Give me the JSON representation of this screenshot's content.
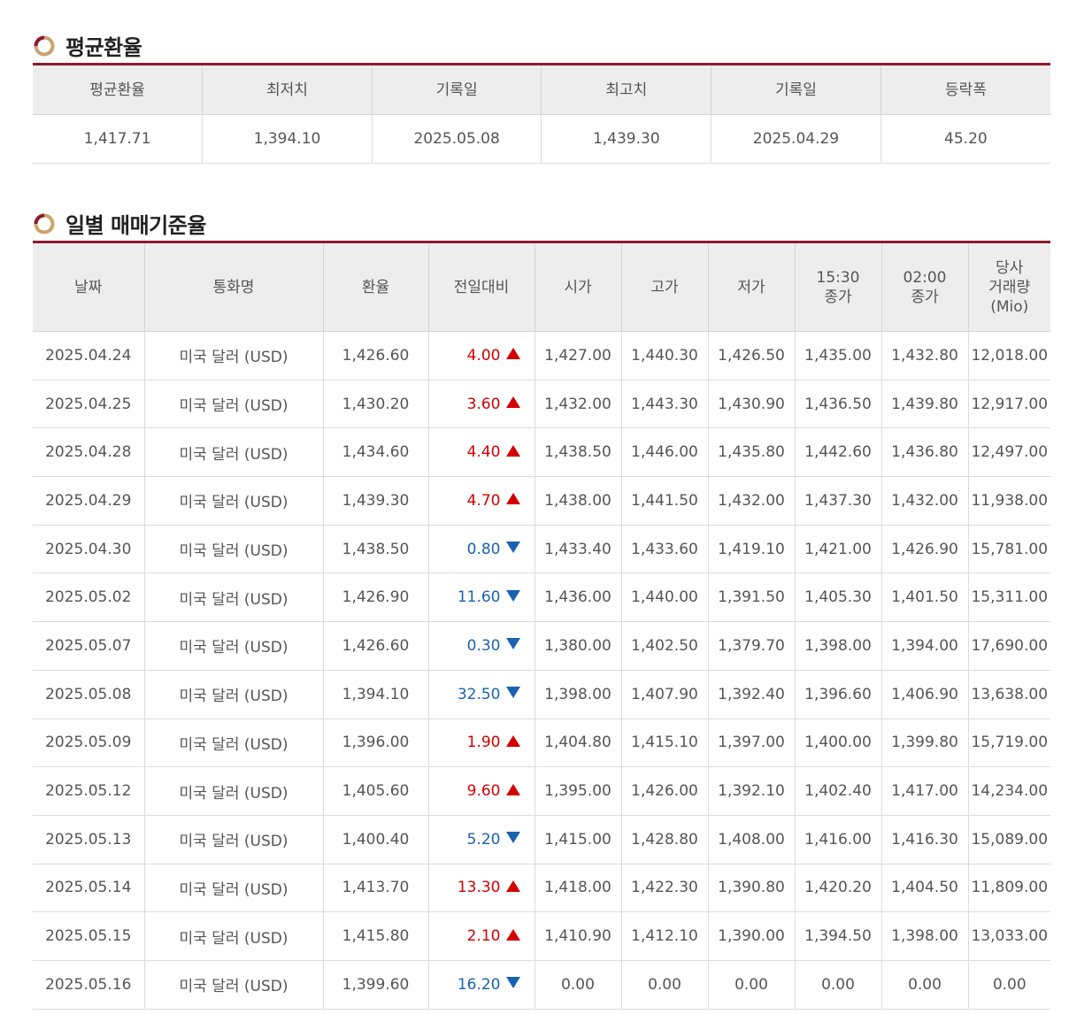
{
  "avg_section": {
    "title": "평균환율",
    "headers": [
      "평균환율",
      "최저치",
      "기록일",
      "최고치",
      "기록일",
      "등락폭"
    ],
    "values": [
      "1,417.71",
      "1,394.10",
      "2025.05.08",
      "1,439.30",
      "2025.04.29",
      "45.20"
    ]
  },
  "daily_section": {
    "title": "일별 매매기준율",
    "headers": {
      "date": "날짜",
      "currency": "통화명",
      "rate": "환율",
      "change": "전일대비",
      "open": "시가",
      "high": "고가",
      "low": "저가",
      "close1530_l1": "15:30",
      "close1530_l2": "종가",
      "close0200_l1": "02:00",
      "close0200_l2": "종가",
      "volume_l1": "당사",
      "volume_l2": "거래량",
      "volume_l3": "(Mio)"
    },
    "rows": [
      {
        "date": "2025.04.24",
        "currency": "미국 달러 (USD)",
        "rate": "1,426.60",
        "change": "4.00",
        "dir": "up",
        "open": "1,427.00",
        "high": "1,440.30",
        "low": "1,426.50",
        "c1530": "1,435.00",
        "c0200": "1,432.80",
        "volume": "12,018.00"
      },
      {
        "date": "2025.04.25",
        "currency": "미국 달러 (USD)",
        "rate": "1,430.20",
        "change": "3.60",
        "dir": "up",
        "open": "1,432.00",
        "high": "1,443.30",
        "low": "1,430.90",
        "c1530": "1,436.50",
        "c0200": "1,439.80",
        "volume": "12,917.00"
      },
      {
        "date": "2025.04.28",
        "currency": "미국 달러 (USD)",
        "rate": "1,434.60",
        "change": "4.40",
        "dir": "up",
        "open": "1,438.50",
        "high": "1,446.00",
        "low": "1,435.80",
        "c1530": "1,442.60",
        "c0200": "1,436.80",
        "volume": "12,497.00"
      },
      {
        "date": "2025.04.29",
        "currency": "미국 달러 (USD)",
        "rate": "1,439.30",
        "change": "4.70",
        "dir": "up",
        "open": "1,438.00",
        "high": "1,441.50",
        "low": "1,432.00",
        "c1530": "1,437.30",
        "c0200": "1,432.00",
        "volume": "11,938.00"
      },
      {
        "date": "2025.04.30",
        "currency": "미국 달러 (USD)",
        "rate": "1,438.50",
        "change": "0.80",
        "dir": "down",
        "open": "1,433.40",
        "high": "1,433.60",
        "low": "1,419.10",
        "c1530": "1,421.00",
        "c0200": "1,426.90",
        "volume": "15,781.00"
      },
      {
        "date": "2025.05.02",
        "currency": "미국 달러 (USD)",
        "rate": "1,426.90",
        "change": "11.60",
        "dir": "down",
        "open": "1,436.00",
        "high": "1,440.00",
        "low": "1,391.50",
        "c1530": "1,405.30",
        "c0200": "1,401.50",
        "volume": "15,311.00"
      },
      {
        "date": "2025.05.07",
        "currency": "미국 달러 (USD)",
        "rate": "1,426.60",
        "change": "0.30",
        "dir": "down",
        "open": "1,380.00",
        "high": "1,402.50",
        "low": "1,379.70",
        "c1530": "1,398.00",
        "c0200": "1,394.00",
        "volume": "17,690.00"
      },
      {
        "date": "2025.05.08",
        "currency": "미국 달러 (USD)",
        "rate": "1,394.10",
        "change": "32.50",
        "dir": "down",
        "open": "1,398.00",
        "high": "1,407.90",
        "low": "1,392.40",
        "c1530": "1,396.60",
        "c0200": "1,406.90",
        "volume": "13,638.00"
      },
      {
        "date": "2025.05.09",
        "currency": "미국 달러 (USD)",
        "rate": "1,396.00",
        "change": "1.90",
        "dir": "up",
        "open": "1,404.80",
        "high": "1,415.10",
        "low": "1,397.00",
        "c1530": "1,400.00",
        "c0200": "1,399.80",
        "volume": "15,719.00"
      },
      {
        "date": "2025.05.12",
        "currency": "미국 달러 (USD)",
        "rate": "1,405.60",
        "change": "9.60",
        "dir": "up",
        "open": "1,395.00",
        "high": "1,426.00",
        "low": "1,392.10",
        "c1530": "1,402.40",
        "c0200": "1,417.00",
        "volume": "14,234.00"
      },
      {
        "date": "2025.05.13",
        "currency": "미국 달러 (USD)",
        "rate": "1,400.40",
        "change": "5.20",
        "dir": "down",
        "open": "1,415.00",
        "high": "1,428.80",
        "low": "1,408.00",
        "c1530": "1,416.00",
        "c0200": "1,416.30",
        "volume": "15,089.00"
      },
      {
        "date": "2025.05.14",
        "currency": "미국 달러 (USD)",
        "rate": "1,413.70",
        "change": "13.30",
        "dir": "up",
        "open": "1,418.00",
        "high": "1,422.30",
        "low": "1,390.80",
        "c1530": "1,420.20",
        "c0200": "1,404.50",
        "volume": "11,809.00"
      },
      {
        "date": "2025.05.15",
        "currency": "미국 달러 (USD)",
        "rate": "1,415.80",
        "change": "2.10",
        "dir": "up",
        "open": "1,410.90",
        "high": "1,412.10",
        "low": "1,390.00",
        "c1530": "1,394.50",
        "c0200": "1,398.00",
        "volume": "13,033.00"
      },
      {
        "date": "2025.05.16",
        "currency": "미국 달러 (USD)",
        "rate": "1,399.60",
        "change": "16.20",
        "dir": "down",
        "open": "0.00",
        "high": "0.00",
        "low": "0.00",
        "c1530": "0.00",
        "c0200": "0.00",
        "volume": "0.00"
      }
    ]
  },
  "colors": {
    "accent": "#8c1a2e",
    "up": "#d20000",
    "down": "#1a62b0",
    "header_bg": "#ededed"
  },
  "icons": {
    "section_bullet": "title-ring-icon",
    "up": "triangle-up-icon",
    "down": "triangle-down-icon"
  }
}
